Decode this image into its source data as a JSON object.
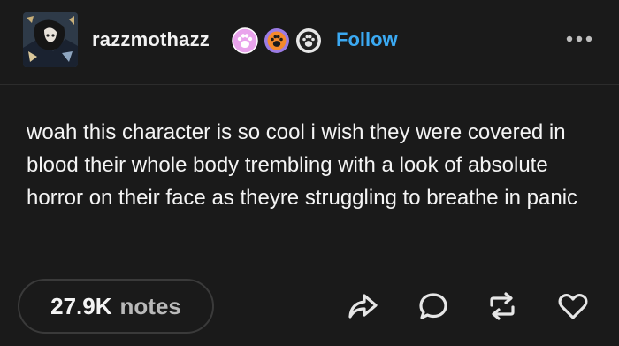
{
  "post": {
    "username": "razzmothazz",
    "follow_label": "Follow",
    "text": "woah this character is so cool i wish they were covered in blood their whole body trembling with a look of absolute horror on their face as theyre struggling to breathe in panic",
    "notes_count": "27.9K",
    "notes_label": "notes"
  },
  "icons": {
    "more": "more-horizontal-icon",
    "share": "share-icon",
    "reply": "reply-icon",
    "reblog": "reblog-icon",
    "like": "heart-icon"
  },
  "colors": {
    "background": "#1a1a1a",
    "accent": "#3ba9f2",
    "badge_pink": "#e9a3ec",
    "badge_orange": "#f58a2c",
    "badge_purple": "#9b7be3"
  }
}
